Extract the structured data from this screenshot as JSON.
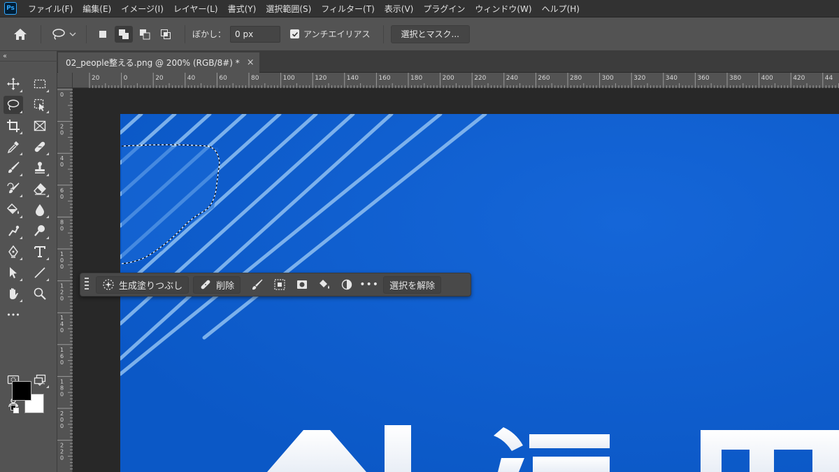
{
  "app": {
    "logo": "Ps"
  },
  "menu": [
    "ファイル(F)",
    "編集(E)",
    "イメージ(I)",
    "レイヤー(L)",
    "書式(Y)",
    "選択範囲(S)",
    "フィルター(T)",
    "表示(V)",
    "プラグイン",
    "ウィンドウ(W)",
    "ヘルプ(H)"
  ],
  "options": {
    "feather_label": "ぼかし：",
    "feather_value": "0 px",
    "antialias_label": "アンチエイリアス",
    "antialias_checked": true,
    "select_mask_label": "選択とマスク..."
  },
  "document": {
    "tab_title": "02_people整える.png @ 200% (RGB/8#) *",
    "close_glyph": "×",
    "canvas_color": "#0e5fd1"
  },
  "ruler": {
    "h_labels": [
      "20",
      "0",
      "20",
      "40",
      "60",
      "80",
      "100",
      "120",
      "140",
      "160",
      "180",
      "200",
      "220",
      "240",
      "260",
      "280",
      "300",
      "320",
      "340",
      "360",
      "380",
      "400",
      "420",
      "44"
    ],
    "v_labels": [
      "0",
      "2\n0",
      "4\n0",
      "6\n0",
      "8\n0",
      "1\n0\n0",
      "1\n2\n0",
      "1\n4\n0",
      "1\n6\n0",
      "1\n8\n0",
      "2\n0\n0",
      "2\n2\n0"
    ]
  },
  "taskbar": {
    "generative_fill_label": "生成塗りつぶし",
    "delete_label": "削除",
    "more_label": "•••",
    "deselect_label": "選択を解除"
  },
  "toolbar": {
    "collapse_glyph": "‹‹",
    "more_glyph": "•••",
    "swap_glyph": "↶",
    "foreground_color": "#000000",
    "background_color": "#ffffff"
  },
  "colors": {
    "accent_ps": "#31a8ff",
    "panel": "#535353",
    "menubar": "#323232"
  }
}
